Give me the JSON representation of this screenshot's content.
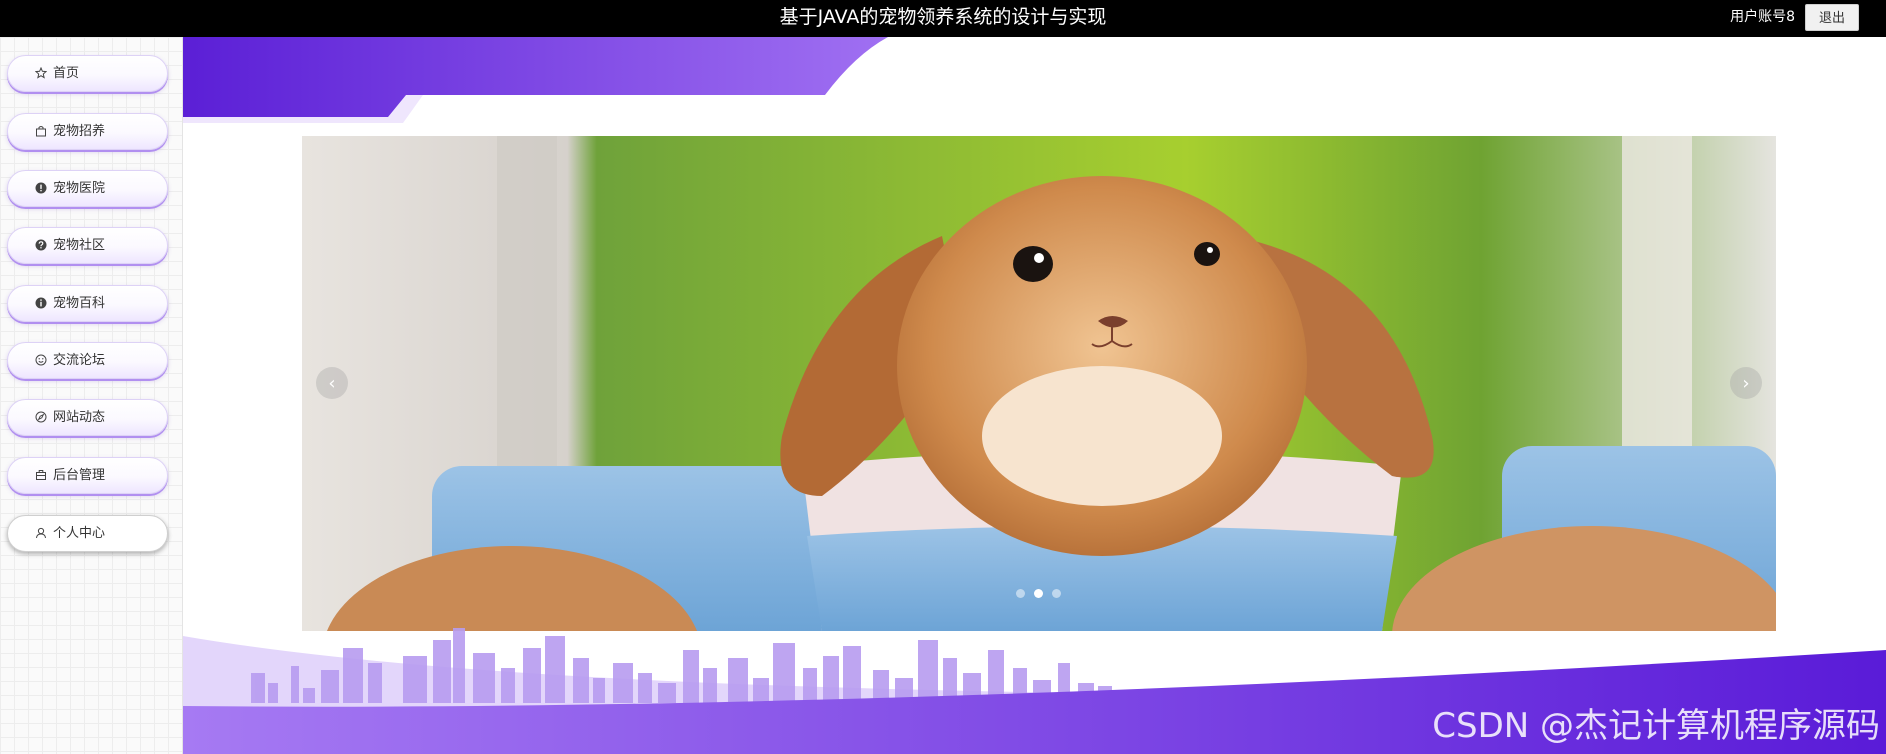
{
  "header": {
    "title": "基于JAVA的宠物领养系统的设计与实现",
    "user_label": "用户账号8",
    "logout_label": "退出"
  },
  "sidebar": {
    "items": [
      {
        "label": "首页",
        "icon": "star-icon"
      },
      {
        "label": "宠物招养",
        "icon": "bag-icon"
      },
      {
        "label": "宠物医院",
        "icon": "alert-circle-icon"
      },
      {
        "label": "宠物社区",
        "icon": "question-circle-icon"
      },
      {
        "label": "宠物百科",
        "icon": "info-circle-icon"
      },
      {
        "label": "交流论坛",
        "icon": "smile-icon"
      },
      {
        "label": "网站动态",
        "icon": "compass-icon"
      },
      {
        "label": "后台管理",
        "icon": "briefcase-icon"
      },
      {
        "label": "个人中心",
        "icon": "user-icon"
      }
    ],
    "active_index": 8
  },
  "carousel": {
    "slide_count": 3,
    "active_slide": 1,
    "image_subject": "rabbit in a blue pot"
  },
  "colors": {
    "accent": "#6a2ee0",
    "accent_light": "#9a6cf2",
    "city": "#b79cf0"
  },
  "watermark": "CSDN @杰记计算机程序源码"
}
